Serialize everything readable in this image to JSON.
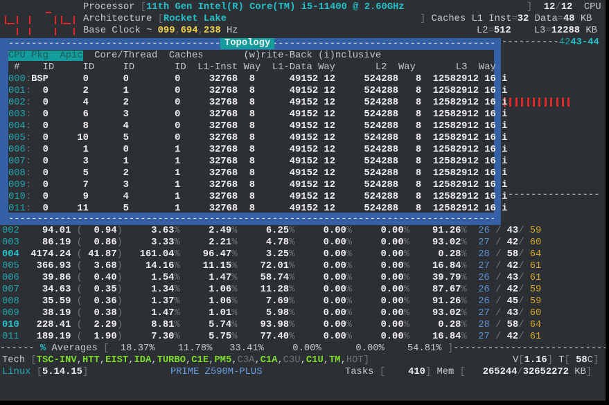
{
  "header": {
    "processor_label": "Processor",
    "processor_value": "11th Gen Intel(R) Core(TM) i5-11400 @ 2.60GHz",
    "cpu_count_online": "12",
    "cpu_count_total": "12",
    "cpu_label": "CPU",
    "architecture_label": "Architecture",
    "architecture_value": "Rocket Lake",
    "caches_label": "Caches",
    "l1_inst_label": "L1 Inst",
    "l1_inst_value": "32",
    "l1_data_label": "Data",
    "l1_data_value": "48",
    "kb": "KB",
    "l2_label": "L2",
    "l2_value": "512",
    "l3_label": "L3",
    "l3_value": "12288",
    "base_clock_label": "Base Clock ~",
    "base_clock_parts": [
      "099",
      "694",
      "238"
    ],
    "base_clock_unit": "Hz",
    "ruler_dim": "42",
    "ruler_bright": "43-44"
  },
  "topology": {
    "title": "Topology",
    "header1": {
      "highlight": "CPU Pkg  Apic",
      "rest": "  Core/Thread  Caches       (w)rite-Back (i)nclusive"
    },
    "header2": " #    ID     ID     ID       ID  L1-Inst Way  L1-Data Way       L2  Way       L3  Way",
    "rows": [
      {
        "cpu": "000",
        "pkg": "BSP",
        "apic": "0",
        "core": "0",
        "thread": "0",
        "l1i": "32768",
        "l1i_way": "8",
        "l1d": "49152",
        "l1d_way": "12",
        "l2": "524288",
        "l2_way": "8",
        "l3": "12582912",
        "l3_way": "16",
        "flag": "i"
      },
      {
        "cpu": "001",
        "pkg": "0",
        "apic": "2",
        "core": "1",
        "thread": "0",
        "l1i": "32768",
        "l1i_way": "8",
        "l1d": "49152",
        "l1d_way": "12",
        "l2": "524288",
        "l2_way": "8",
        "l3": "12582912",
        "l3_way": "16",
        "flag": "i"
      },
      {
        "cpu": "002",
        "pkg": "0",
        "apic": "4",
        "core": "2",
        "thread": "0",
        "l1i": "32768",
        "l1i_way": "8",
        "l1d": "49152",
        "l1d_way": "12",
        "l2": "524288",
        "l2_way": "8",
        "l3": "12582912",
        "l3_way": "16",
        "flag": "i"
      },
      {
        "cpu": "003",
        "pkg": "0",
        "apic": "6",
        "core": "3",
        "thread": "0",
        "l1i": "32768",
        "l1i_way": "8",
        "l1d": "49152",
        "l1d_way": "12",
        "l2": "524288",
        "l2_way": "8",
        "l3": "12582912",
        "l3_way": "16",
        "flag": "i"
      },
      {
        "cpu": "004",
        "pkg": "0",
        "apic": "8",
        "core": "4",
        "thread": "0",
        "l1i": "32768",
        "l1i_way": "8",
        "l1d": "49152",
        "l1d_way": "12",
        "l2": "524288",
        "l2_way": "8",
        "l3": "12582912",
        "l3_way": "16",
        "flag": "i"
      },
      {
        "cpu": "005",
        "pkg": "0",
        "apic": "10",
        "core": "5",
        "thread": "0",
        "l1i": "32768",
        "l1i_way": "8",
        "l1d": "49152",
        "l1d_way": "12",
        "l2": "524288",
        "l2_way": "8",
        "l3": "12582912",
        "l3_way": "16",
        "flag": "i"
      },
      {
        "cpu": "006",
        "pkg": "0",
        "apic": "1",
        "core": "0",
        "thread": "1",
        "l1i": "32768",
        "l1i_way": "8",
        "l1d": "49152",
        "l1d_way": "12",
        "l2": "524288",
        "l2_way": "8",
        "l3": "12582912",
        "l3_way": "16",
        "flag": "i"
      },
      {
        "cpu": "007",
        "pkg": "0",
        "apic": "3",
        "core": "1",
        "thread": "1",
        "l1i": "32768",
        "l1i_way": "8",
        "l1d": "49152",
        "l1d_way": "12",
        "l2": "524288",
        "l2_way": "8",
        "l3": "12582912",
        "l3_way": "16",
        "flag": "i"
      },
      {
        "cpu": "008",
        "pkg": "0",
        "apic": "5",
        "core": "2",
        "thread": "1",
        "l1i": "32768",
        "l1i_way": "8",
        "l1d": "49152",
        "l1d_way": "12",
        "l2": "524288",
        "l2_way": "8",
        "l3": "12582912",
        "l3_way": "16",
        "flag": "i"
      },
      {
        "cpu": "009",
        "pkg": "0",
        "apic": "7",
        "core": "3",
        "thread": "1",
        "l1i": "32768",
        "l1i_way": "8",
        "l1d": "49152",
        "l1d_way": "12",
        "l2": "524288",
        "l2_way": "8",
        "l3": "12582912",
        "l3_way": "16",
        "flag": "i"
      },
      {
        "cpu": "010",
        "pkg": "0",
        "apic": "9",
        "core": "4",
        "thread": "1",
        "l1i": "32768",
        "l1i_way": "8",
        "l1d": "49152",
        "l1d_way": "12",
        "l2": "524288",
        "l2_way": "8",
        "l3": "12582912",
        "l3_way": "16",
        "flag": "i"
      },
      {
        "cpu": "011",
        "pkg": "0",
        "apic": "11",
        "core": "5",
        "thread": "1",
        "l1i": "32768",
        "l1i_way": "8",
        "l1d": "49152",
        "l1d_way": "12",
        "l2": "524288",
        "l2_way": "8",
        "l3": "12582912",
        "l3_way": "16",
        "flag": "i"
      }
    ]
  },
  "monitor": {
    "rows": [
      {
        "cpu": "002",
        "freq": "94.01",
        "ratio": "0.94",
        "turbo": "3.63",
        "c0": "2.49",
        "c1": "6.25",
        "c3": "0.00",
        "c6": "0.00",
        "c7": "91.26",
        "tmin": "26",
        "temp": "43",
        "tmax": "59",
        "hot": false
      },
      {
        "cpu": "003",
        "freq": "86.19",
        "ratio": "0.86",
        "turbo": "3.33",
        "c0": "2.21",
        "c1": "4.78",
        "c3": "0.00",
        "c6": "0.00",
        "c7": "93.02",
        "tmin": "27",
        "temp": "42",
        "tmax": "60",
        "hot": false
      },
      {
        "cpu": "004",
        "freq": "4174.24",
        "ratio": "41.87",
        "turbo": "161.04",
        "c0": "96.47",
        "c1": "3.25",
        "c3": "0.00",
        "c6": "0.00",
        "c7": "0.28",
        "tmin": "28",
        "temp": "58",
        "tmax": "64",
        "hot": true
      },
      {
        "cpu": "005",
        "freq": "366.93",
        "ratio": "3.68",
        "turbo": "14.16",
        "c0": "11.15",
        "c1": "72.01",
        "c3": "0.00",
        "c6": "0.00",
        "c7": "16.84",
        "tmin": "27",
        "temp": "42",
        "tmax": "61",
        "hot": false
      },
      {
        "cpu": "006",
        "freq": "39.86",
        "ratio": "0.40",
        "turbo": "1.54",
        "c0": "1.47",
        "c1": "58.74",
        "c3": "0.00",
        "c6": "0.00",
        "c7": "39.79",
        "tmin": "26",
        "temp": "43",
        "tmax": "61",
        "hot": false
      },
      {
        "cpu": "007",
        "freq": "34.63",
        "ratio": "0.35",
        "turbo": "1.34",
        "c0": "1.06",
        "c1": "11.28",
        "c3": "0.00",
        "c6": "0.00",
        "c7": "87.67",
        "tmin": "26",
        "temp": "42",
        "tmax": "59",
        "hot": false
      },
      {
        "cpu": "008",
        "freq": "35.59",
        "ratio": "0.36",
        "turbo": "1.37",
        "c0": "1.06",
        "c1": "7.69",
        "c3": "0.00",
        "c6": "0.00",
        "c7": "91.26",
        "tmin": "26",
        "temp": "45",
        "tmax": "59",
        "hot": false
      },
      {
        "cpu": "009",
        "freq": "38.19",
        "ratio": "0.38",
        "turbo": "1.47",
        "c0": "1.01",
        "c1": "5.98",
        "c3": "0.00",
        "c6": "0.00",
        "c7": "93.02",
        "tmin": "27",
        "temp": "43",
        "tmax": "60",
        "hot": false
      },
      {
        "cpu": "010",
        "freq": "228.41",
        "ratio": "2.29",
        "turbo": "8.81",
        "c0": "5.74",
        "c1": "93.98",
        "c3": "0.00",
        "c6": "0.00",
        "c7": "0.28",
        "tmin": "28",
        "temp": "58",
        "tmax": "64",
        "hot": true
      },
      {
        "cpu": "011",
        "freq": "189.19",
        "ratio": "1.90",
        "turbo": "7.30",
        "c0": "5.75",
        "c1": "77.40",
        "c3": "0.00",
        "c6": "0.00",
        "c7": "16.84",
        "tmin": "27",
        "temp": "42",
        "tmax": "61",
        "hot": false
      }
    ],
    "averages": {
      "label": "Averages",
      "values": [
        "18.37%",
        "11.78%",
        "33.41%",
        "0.00%",
        "0.00%",
        "54.81%"
      ]
    }
  },
  "footer": {
    "tech_label": "Tech",
    "tech_flags": [
      {
        "name": "TSC-INV",
        "on": true
      },
      {
        "name": "HTT",
        "on": true
      },
      {
        "name": "EIST",
        "on": true
      },
      {
        "name": "IDA",
        "on": true
      },
      {
        "name": "TURBO",
        "on": true
      },
      {
        "name": "C1E",
        "on": true
      },
      {
        "name": "PM5",
        "on": true
      },
      {
        "name": "C3A",
        "on": false
      },
      {
        "name": "C1A",
        "on": true
      },
      {
        "name": "C3U",
        "on": false
      },
      {
        "name": "C1U",
        "on": true
      },
      {
        "name": "TM",
        "on": true
      },
      {
        "name": "HOT",
        "on": false
      }
    ],
    "voltage_label": "V",
    "voltage_value": "1.16",
    "temp_label": "T",
    "temp_value": "58",
    "temp_unit": "C",
    "os_label": "Linux",
    "kernel": "5.14.15",
    "board": "PRIME Z590M-PLUS",
    "tasks_label": "Tasks",
    "tasks_value": "410",
    "mem_label": "Mem",
    "mem_used": "265244",
    "mem_total": "32652272",
    "mem_unit": "KB"
  },
  "colors": {
    "background": "#2c3034",
    "window_frame": "#3560a6",
    "title_accent": "#139c9c",
    "highlight_cyan": "#22c0c8",
    "alert_red": "#e02828",
    "flag_green": "#7edc2a",
    "temp_gold": "#d4a82a"
  }
}
